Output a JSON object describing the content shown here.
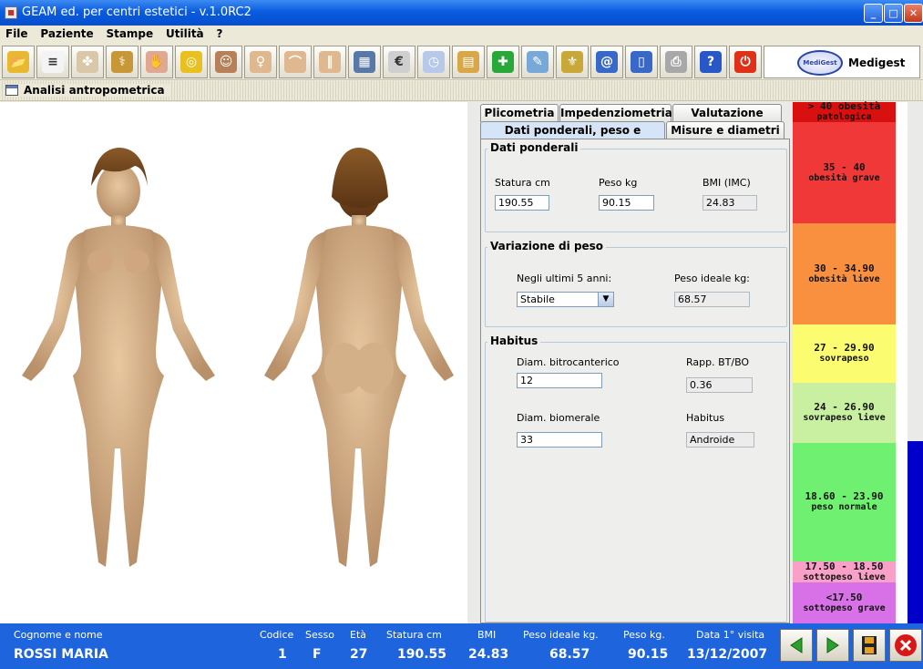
{
  "window": {
    "title": "GEAM ed. per centri estetici - v.1.0RC2"
  },
  "menu": [
    "File",
    "Paziente",
    "Stampe",
    "Utilità",
    "?"
  ],
  "toolbar": {
    "buttons": [
      {
        "name": "open-folder-icon",
        "color": "#e8b830"
      },
      {
        "name": "document-icon",
        "color": "#f4f4f4"
      },
      {
        "name": "vitruvian-man-icon",
        "color": "#d8c8a8"
      },
      {
        "name": "caduceus-icon",
        "color": "#c89838"
      },
      {
        "name": "hand-icon",
        "color": "#e0a890"
      },
      {
        "name": "measuring-tape-icon",
        "color": "#e8c020"
      },
      {
        "name": "face-icon",
        "color": "#b88058"
      },
      {
        "name": "torso-icon",
        "color": "#e0b890"
      },
      {
        "name": "hips-icon",
        "color": "#e0b890"
      },
      {
        "name": "legs-icon",
        "color": "#e0b890"
      },
      {
        "name": "calculator-icon",
        "color": "#5878a8"
      },
      {
        "name": "euro-icon",
        "color": "#cfcfcf"
      },
      {
        "name": "clock-icon",
        "color": "#b8c8e8"
      },
      {
        "name": "book-icon",
        "color": "#d8a848"
      },
      {
        "name": "pharmacy-cross-icon",
        "color": "#28a838"
      },
      {
        "name": "notepad-icon",
        "color": "#78a8d8"
      },
      {
        "name": "emblem-icon",
        "color": "#c8a838"
      },
      {
        "name": "email-at-icon",
        "color": "#3868c8"
      },
      {
        "name": "contacts-icon",
        "color": "#3868c8"
      },
      {
        "name": "printer-icon",
        "color": "#a8a8a8"
      },
      {
        "name": "help-icon",
        "color": "#2858c8"
      },
      {
        "name": "power-icon",
        "color": "#e03018"
      }
    ],
    "brand": {
      "logo_text": "MediGest",
      "name": "Medigest"
    }
  },
  "subwindow": {
    "title": "Analisi antropometrica"
  },
  "tabs": {
    "row1": [
      "Plicometria",
      "Impedenziometria",
      "Valutazione fisica"
    ],
    "row2": [
      "Dati ponderali, peso e habitus",
      "Misure e diametri"
    ]
  },
  "dati_ponderali": {
    "title": "Dati ponderali",
    "statura_label": "Statura cm",
    "statura_value": "190.55",
    "peso_label": "Peso kg",
    "peso_value": "90.15",
    "bmi_label": "BMI (IMC)",
    "bmi_value": "24.83"
  },
  "variazione_peso": {
    "title": "Variazione di peso",
    "ultimi_label": "Negli ultimi 5 anni:",
    "ultimi_value": "Stabile",
    "peso_ideale_label": "Peso ideale kg:",
    "peso_ideale_value": "68.57"
  },
  "habitus": {
    "title": "Habitus",
    "bitro_label": "Diam. bitrocanterico",
    "bitro_value": "12",
    "rapp_label": "Rapp. BT/BO",
    "rapp_value": "0.36",
    "biom_label": "Diam. biomerale",
    "biom_value": "33",
    "habitus_label": "Habitus",
    "habitus_value": "Androide"
  },
  "bmi_scale": [
    {
      "range": "> 40 obesità",
      "label": "patologica",
      "color": "#d81010"
    },
    {
      "range": "35 - 40",
      "label": "obesità grave",
      "color": "#f03838"
    },
    {
      "range": "30 - 34.90",
      "label": "obesità lieve",
      "color": "#f89040"
    },
    {
      "range": "27 - 29.90",
      "label": "sovrapeso",
      "color": "#fcfc70"
    },
    {
      "range": "24 - 26.90",
      "label": "sovrapeso lieve",
      "color": "#c8f0a0"
    },
    {
      "range": "18.60 - 23.90",
      "label": "peso normale",
      "color": "#70f070"
    },
    {
      "range": "17.50 - 18.50",
      "label": "sottopeso lieve",
      "color": "#f8a0c8"
    },
    {
      "range": "<17.50",
      "label": "sottopeso grave",
      "color": "#d870e8"
    }
  ],
  "bmi_fill_fraction": 0.35,
  "status": {
    "labels": {
      "nome": "Cognome e nome",
      "codice": "Codice",
      "sesso": "Sesso",
      "eta": "Età",
      "statura": "Statura cm",
      "bmi": "BMI",
      "peso_ideale": "Peso ideale  kg.",
      "peso": "Peso kg.",
      "data": "Data 1° visita"
    },
    "values": {
      "nome": "ROSSI MARIA",
      "codice": "1",
      "sesso": "F",
      "eta": "27",
      "statura": "190.55",
      "bmi": "24.83",
      "peso_ideale": "68.57",
      "peso": "90.15",
      "data": "13/12/2007"
    }
  }
}
